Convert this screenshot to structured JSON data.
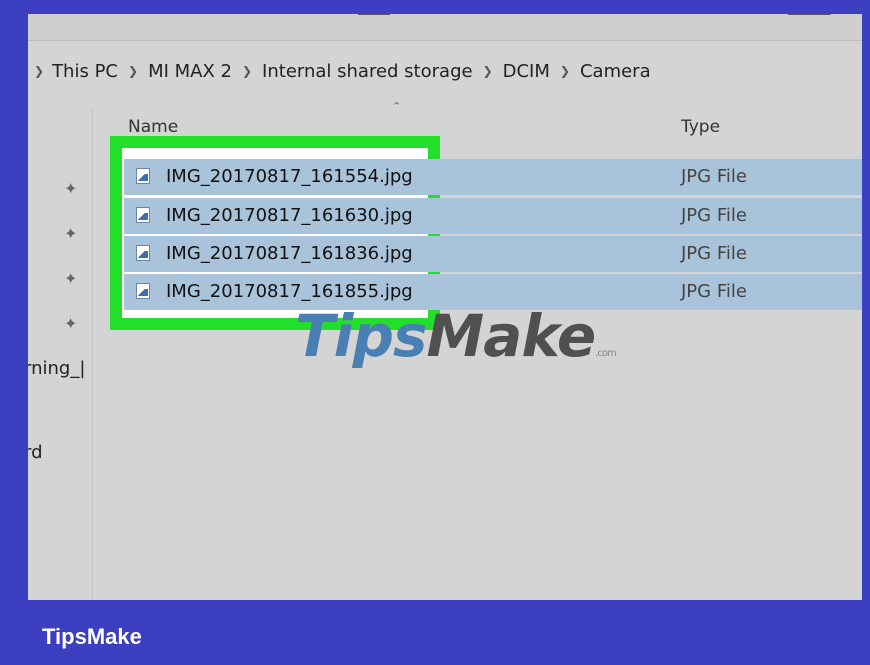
{
  "topbar": {
    "cut_left": "ಯಿನ್",
    "cut_right": "ಯಿಂ"
  },
  "breadcrumb": {
    "items": [
      "This PC",
      "MI MAX 2",
      "Internal shared storage",
      "DCIM",
      "Camera"
    ]
  },
  "nav": {
    "items": [
      "rning_|",
      "rd"
    ]
  },
  "columns": {
    "name": "Name",
    "type": "Type"
  },
  "files": [
    {
      "name": "IMG_20170817_161554.jpg",
      "type": "JPG File"
    },
    {
      "name": "IMG_20170817_161630.jpg",
      "type": "JPG File"
    },
    {
      "name": "IMG_20170817_161836.jpg",
      "type": "JPG File"
    },
    {
      "name": "IMG_20170817_161855.jpg",
      "type": "JPG File"
    }
  ],
  "watermark": {
    "part1": "Tips",
    "part2": "Make",
    "suffix": ".com"
  },
  "footer": {
    "brand": "TipsMake"
  },
  "colors": {
    "selection": "#a9c4da",
    "highlight_border": "#22e02a",
    "frame": "#3b3fc0"
  },
  "icons": {
    "file": "image-file-icon",
    "pin": "pin-icon",
    "chevron": "chevron-right-icon",
    "sort": "sort-up-icon"
  }
}
